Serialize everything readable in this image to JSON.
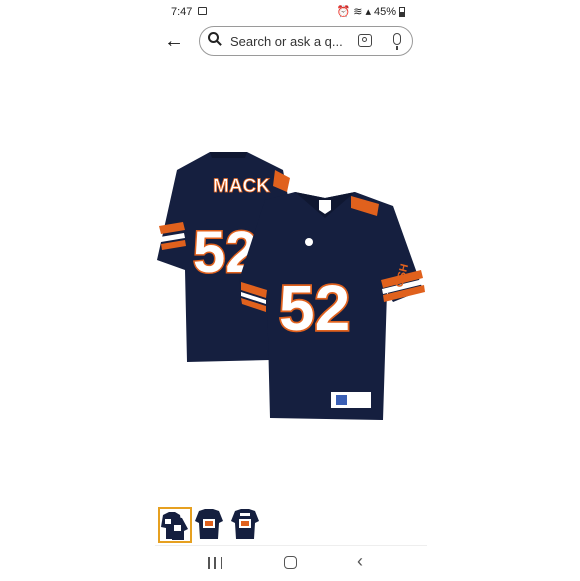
{
  "status_bar": {
    "time": "7:47",
    "battery": "45%"
  },
  "search": {
    "placeholder": "Search or ask a q..."
  },
  "product": {
    "jersey_name": "MACK",
    "jersey_number": "52",
    "sleeve_logo": "GSH",
    "colors": {
      "navy": "#151f3f",
      "orange": "#e0611d",
      "white": "#ffffff"
    }
  },
  "thumbnails": {
    "count": 3,
    "selected_index": 0,
    "selected_color": "#e6a020"
  },
  "nav": {
    "recent": "recent-apps-icon",
    "home": "home-icon",
    "back": "back-icon"
  }
}
